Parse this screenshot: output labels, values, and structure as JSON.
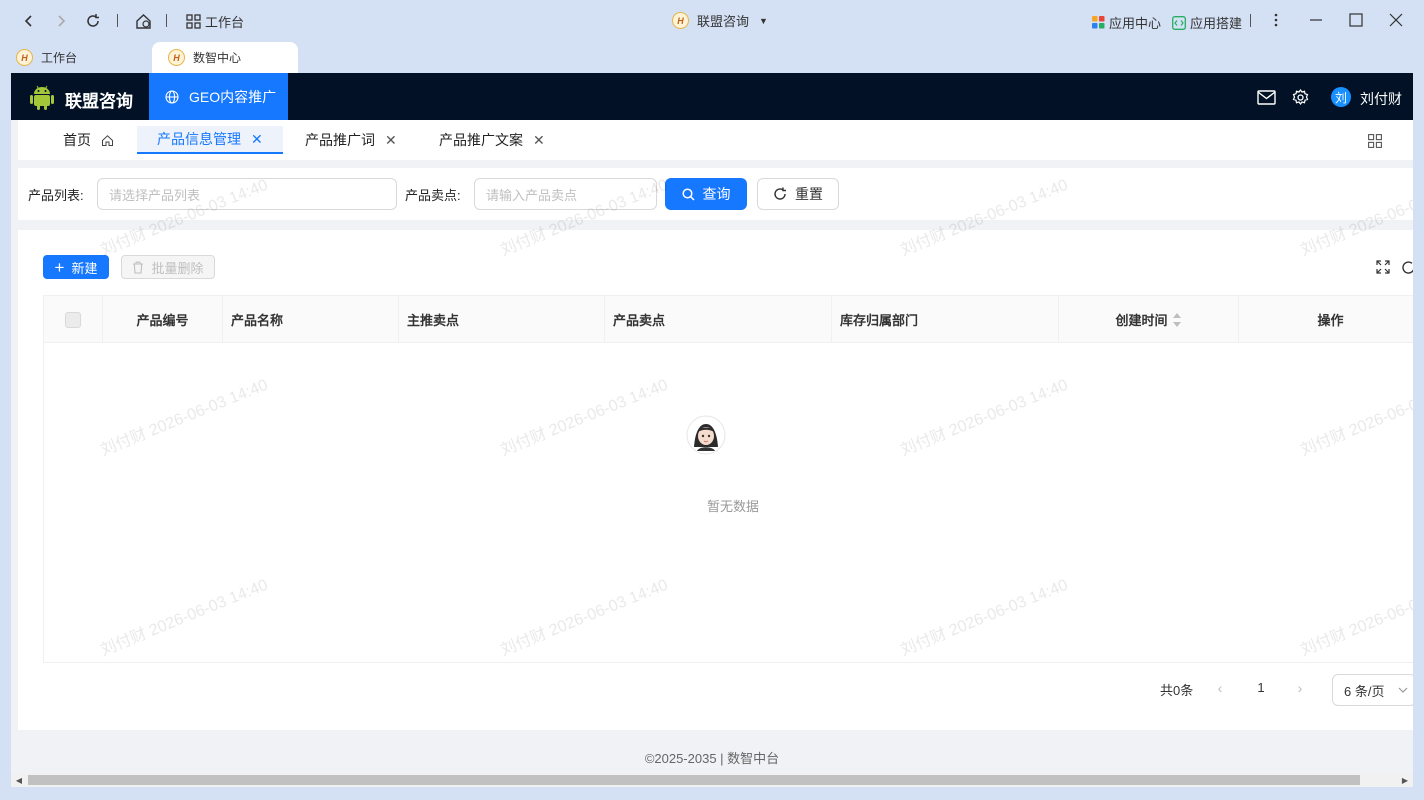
{
  "browser": {
    "workbench_label": "工作台",
    "window_title": "联盟咨询",
    "app_center": "应用中心",
    "app_builder": "应用搭建",
    "tabs": [
      {
        "label": "工作台"
      },
      {
        "label": "数智中心"
      }
    ],
    "logo_letter": "H"
  },
  "header": {
    "app_name": "联盟咨询",
    "menu_item": "GEO内容推广",
    "avatar_char": "刘",
    "user_name": "刘付财"
  },
  "page_tabs": [
    {
      "label": "首页"
    },
    {
      "label": "产品信息管理"
    },
    {
      "label": "产品推广词"
    },
    {
      "label": "产品推广文案"
    }
  ],
  "search": {
    "product_list_label": "产品列表:",
    "product_list_placeholder": "请选择产品列表",
    "selling_point_label": "产品卖点:",
    "selling_point_placeholder": "请输入产品卖点",
    "query_button": "查询",
    "reset_button": "重置"
  },
  "toolbar": {
    "new_button": "新建",
    "batch_delete_button": "批量删除"
  },
  "table": {
    "columns": [
      "产品编号",
      "产品名称",
      "主推卖点",
      "产品卖点",
      "库存归属部门",
      "创建时间",
      "操作"
    ],
    "empty_text": "暂无数据"
  },
  "pagination": {
    "total": "共0条",
    "current_page": "1",
    "page_size": "6 条/页"
  },
  "footer": "©2025-2035 | 数智中台",
  "watermark": "刘付财 2026-06-03 14:40",
  "colors": {
    "primary": "#1677ff",
    "header_bg": "#021126"
  }
}
